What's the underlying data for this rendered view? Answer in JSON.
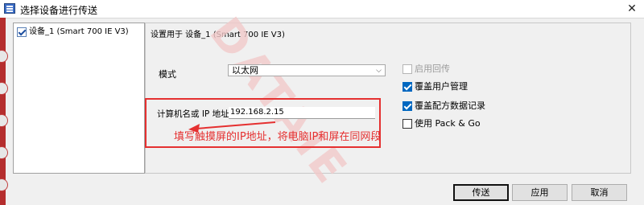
{
  "window": {
    "title": "选择设备进行传送",
    "close_glyph": "✕"
  },
  "device_list": {
    "items": [
      {
        "label": "设备_1 (Smart 700 IE V3)",
        "checked": true
      }
    ]
  },
  "settings": {
    "title": "设置用于 设备_1 (Smart 700 IE V3)",
    "mode_label": "模式",
    "mode_value": "以太网",
    "ip_label": "计算机名或 IP 地址",
    "ip_value": "192.168.2.15"
  },
  "options": [
    {
      "label": "启用回传",
      "checked": false,
      "enabled": false
    },
    {
      "label": "覆盖用户管理",
      "checked": true,
      "enabled": true
    },
    {
      "label": "覆盖配方数据记录",
      "checked": true,
      "enabled": true
    },
    {
      "label": "使用 Pack & Go",
      "checked": false,
      "enabled": true
    }
  ],
  "annotation": {
    "text": "填写触摸屏的IP地址，将电脑IP和屏在同网段",
    "color": "#e53030"
  },
  "watermark": "DATAIE",
  "buttons": {
    "transfer": "传送",
    "apply": "应用",
    "cancel": "取消"
  },
  "colors": {
    "accent": "#0067c0",
    "annotation_red": "#e53030"
  }
}
